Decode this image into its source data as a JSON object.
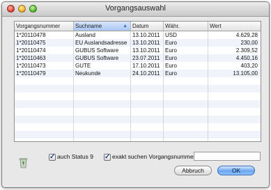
{
  "window": {
    "title": "Vorgangsauswahl"
  },
  "table": {
    "columns": [
      "Vorgangsnummer",
      "Suchname",
      "Datum",
      "Währ.",
      "Wert"
    ],
    "sorted_column": 1,
    "rows": [
      {
        "number": "1*20110478",
        "name": "Ausland",
        "date": "13.10.2011",
        "currency": "USD",
        "value": "4.629,28"
      },
      {
        "number": "1*20110475",
        "name": "EU Auslandsadresse",
        "date": "13.10.2011",
        "currency": "Euro",
        "value": "230,00"
      },
      {
        "number": "1*20110474",
        "name": "GUBUS Software",
        "date": "13.10.2011",
        "currency": "Euro",
        "value": "2.309,52"
      },
      {
        "number": "1*20110463",
        "name": "GUBUS Software",
        "date": "23.07.2011",
        "currency": "Euro",
        "value": "4.450,16"
      },
      {
        "number": "1*20110473",
        "name": "GUTE",
        "date": "17.10.2011",
        "currency": "Euro",
        "value": "403,20"
      },
      {
        "number": "1*20110479",
        "name": "Neukunde",
        "date": "24.10.2011",
        "currency": "Euro",
        "value": "13.105,00"
      }
    ]
  },
  "options": {
    "status9_label": "auch Status 9",
    "status9_checked": true,
    "exact_label": "exakt suchen Vorgangsnummer",
    "exact_checked": true,
    "search_value": ""
  },
  "buttons": {
    "cancel": "Abbruch",
    "ok": "OK"
  },
  "icons": {
    "trash": "trash-icon"
  },
  "colors": {
    "default_button": "#6aa6ef",
    "sorted_header": "#a9c6f1",
    "alt_row": "#f0f3fa"
  }
}
